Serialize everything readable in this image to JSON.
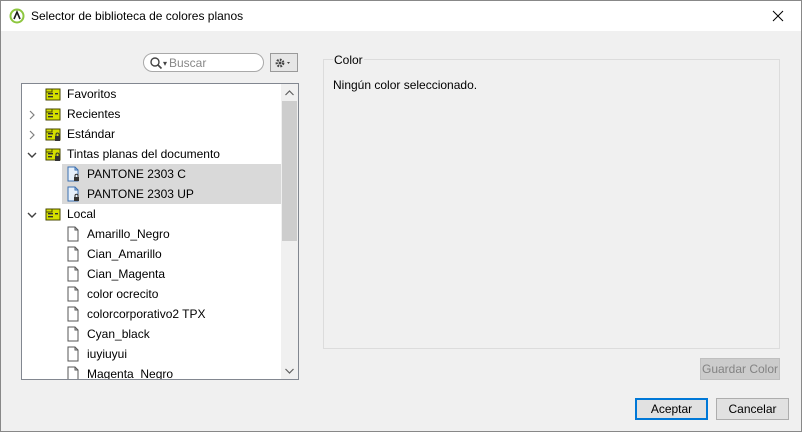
{
  "window": {
    "title": "Selector de biblioteca de colores planos"
  },
  "search": {
    "placeholder": "Buscar",
    "value": ""
  },
  "tree": {
    "items": [
      {
        "label": "Favoritos",
        "expander": "none",
        "icon": "library-folder-icon",
        "selected": false
      },
      {
        "label": "Recientes",
        "expander": "collapsed",
        "icon": "library-folder-icon",
        "selected": false
      },
      {
        "label": "Estándar",
        "expander": "collapsed",
        "icon": "library-folder-locked-icon",
        "selected": false
      },
      {
        "label": "Tintas planas del documento",
        "expander": "expanded",
        "icon": "library-folder-locked-icon",
        "selected": false
      },
      {
        "label": "PANTONE 2303 C",
        "expander": "none",
        "icon": "document-locked-icon",
        "selected": true
      },
      {
        "label": "PANTONE 2303 UP",
        "expander": "none",
        "icon": "document-locked-icon",
        "selected": true
      },
      {
        "label": "Local",
        "expander": "expanded",
        "icon": "library-folder-icon",
        "selected": false
      },
      {
        "label": "Amarillo_Negro",
        "expander": "none",
        "icon": "document-icon",
        "selected": false
      },
      {
        "label": "Cian_Amarillo",
        "expander": "none",
        "icon": "document-icon",
        "selected": false
      },
      {
        "label": "Cian_Magenta",
        "expander": "none",
        "icon": "document-icon",
        "selected": false
      },
      {
        "label": "color ocrecito",
        "expander": "none",
        "icon": "document-icon",
        "selected": false
      },
      {
        "label": "colorcorporativo2 TPX",
        "expander": "none",
        "icon": "document-icon",
        "selected": false
      },
      {
        "label": "Cyan_black",
        "expander": "none",
        "icon": "document-icon",
        "selected": false
      },
      {
        "label": "iuyiuyui",
        "expander": "none",
        "icon": "document-icon",
        "selected": false
      },
      {
        "label": "Magenta_Negro",
        "expander": "none",
        "icon": "document-icon",
        "selected": false
      }
    ]
  },
  "color_panel": {
    "legend": "Color",
    "message": "Ningún color seleccionado.",
    "save_label": "Guardar Color"
  },
  "footer": {
    "accept_label": "Aceptar",
    "cancel_label": "Cancelar"
  },
  "colors": {
    "folder_yellow": "#d4e000",
    "accent": "#0078d7",
    "selection": "#d9d9d9"
  }
}
